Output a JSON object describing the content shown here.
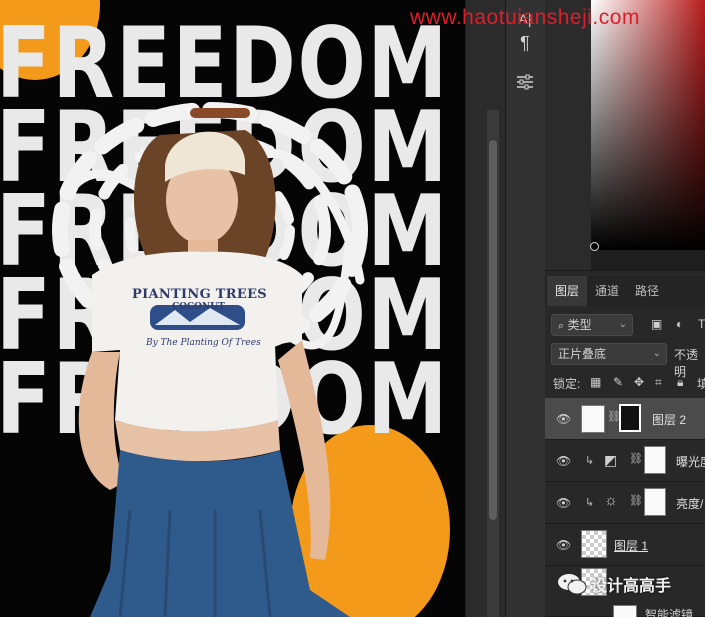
{
  "watermark": "www.haotuiansheji.com",
  "artwork": {
    "headline_lines": [
      "FREEDOM",
      "FREEDOM",
      "FREEDOM",
      "FREEDOM",
      "FREEDOM"
    ],
    "shirt_title": "PIANTING TREES",
    "shirt_subtitle": "COCONUT",
    "shirt_script": "By The Planting Of Trees",
    "colors": {
      "background": "#050505",
      "orange": "#f39a1a",
      "text": "#e9e9e9",
      "denim": "#2f5a8c"
    }
  },
  "toolbar": {
    "items": [
      {
        "icon": "character-icon",
        "label": "A|"
      },
      {
        "icon": "paragraph-icon",
        "label": "¶"
      },
      {
        "icon": "adjust-icon",
        "label": "⚙"
      }
    ]
  },
  "color_picker": {
    "hue_color": "#b81d1d"
  },
  "layers_panel": {
    "tabs": [
      "图层",
      "通道",
      "路径"
    ],
    "active_tab": "图层",
    "filter_kind": "类型",
    "blend_mode": "正片叠底",
    "opacity_label": "不透明",
    "lock_label": "锁定:",
    "fill_label": "填",
    "layers": [
      {
        "name": "图层 2",
        "selected": true
      },
      {
        "name": "曝光度"
      },
      {
        "name": "亮度/"
      },
      {
        "name": "图层 1"
      },
      {
        "name": "智能滤镜"
      }
    ]
  },
  "wechat_watermark": "设计高高手"
}
